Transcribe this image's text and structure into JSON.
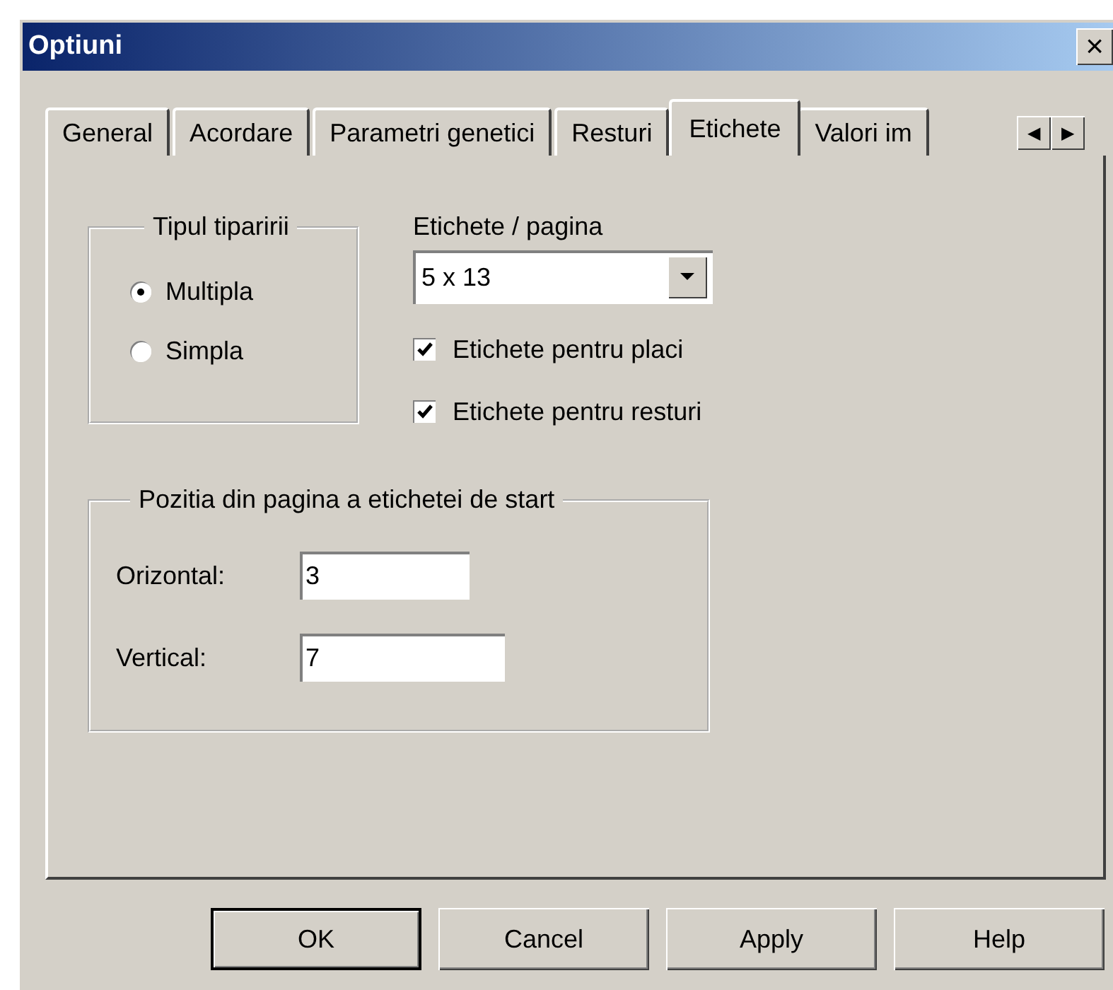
{
  "window": {
    "title": "Optiuni",
    "close_glyph": "×"
  },
  "tabs": [
    {
      "label": "General",
      "selected": false
    },
    {
      "label": "Acordare",
      "selected": false
    },
    {
      "label": "Parametri genetici",
      "selected": false
    },
    {
      "label": "Resturi",
      "selected": false
    },
    {
      "label": "Etichete",
      "selected": true
    },
    {
      "label": "Valori im",
      "selected": false
    }
  ],
  "tab_scroll": {
    "left": "◀",
    "right": "▶"
  },
  "print_type": {
    "title": "Tipul tiparirii",
    "options": [
      {
        "label": "Multipla",
        "selected": true
      },
      {
        "label": "Simpla",
        "selected": false
      }
    ]
  },
  "labels_per_page": {
    "label": "Etichete / pagina",
    "value": "5 x 13"
  },
  "checkboxes": [
    {
      "label": "Etichete pentru placi",
      "checked": true
    },
    {
      "label": "Etichete pentru resturi",
      "checked": true
    }
  ],
  "start_position": {
    "title": "Pozitia din pagina a etichetei de start",
    "fields": [
      {
        "label": "Orizontal:",
        "value": "3"
      },
      {
        "label": "Vertical:",
        "value": "7"
      }
    ]
  },
  "buttons": [
    {
      "label": "OK",
      "default": true
    },
    {
      "label": "Cancel",
      "default": false
    },
    {
      "label": "Apply",
      "default": false
    },
    {
      "label": "Help",
      "default": false
    }
  ]
}
